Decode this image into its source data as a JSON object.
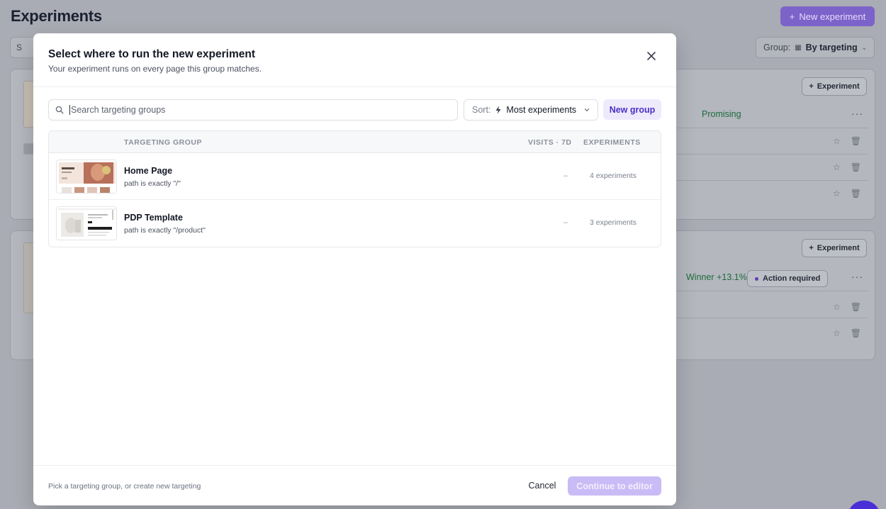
{
  "background": {
    "page_title": "Experiments",
    "new_experiment_label": "New experiment",
    "search_partial": "S",
    "group_label": "Group:",
    "group_value": "By targeting",
    "card1": {
      "experiment_button": "Experiment",
      "status": "Promising"
    },
    "card2": {
      "experiment_button": "Experiment",
      "status": "Winner +13.1%",
      "badge": "Action required"
    }
  },
  "modal": {
    "title": "Select where to run the new experiment",
    "subtitle": "Your experiment runs on every page this group matches.",
    "search": {
      "placeholder": "Search targeting groups",
      "value": ""
    },
    "sort": {
      "label": "Sort:",
      "value": "Most experiments"
    },
    "new_group_label": "New group",
    "table": {
      "headers": {
        "group": "TARGETING GROUP",
        "visits": "VISITS · 7D",
        "experiments": "EXPERIMENTS"
      },
      "rows": [
        {
          "name": "Home Page",
          "rule": "path is exactly \"/\"",
          "visits": "–",
          "experiments": "4 experiments"
        },
        {
          "name": "PDP Template",
          "rule": "path is exactly \"/product\"",
          "visits": "–",
          "experiments": "3 experiments"
        }
      ]
    },
    "footer": {
      "hint": "Pick a targeting group, or create new targeting",
      "cancel_label": "Cancel",
      "continue_label": "Continue to editor"
    }
  },
  "colors": {
    "accent": "#4d2fc6",
    "accent_soft": "#eeeafc",
    "continue_disabled": "#c9bcf6",
    "overlay": "#a9acb4"
  }
}
